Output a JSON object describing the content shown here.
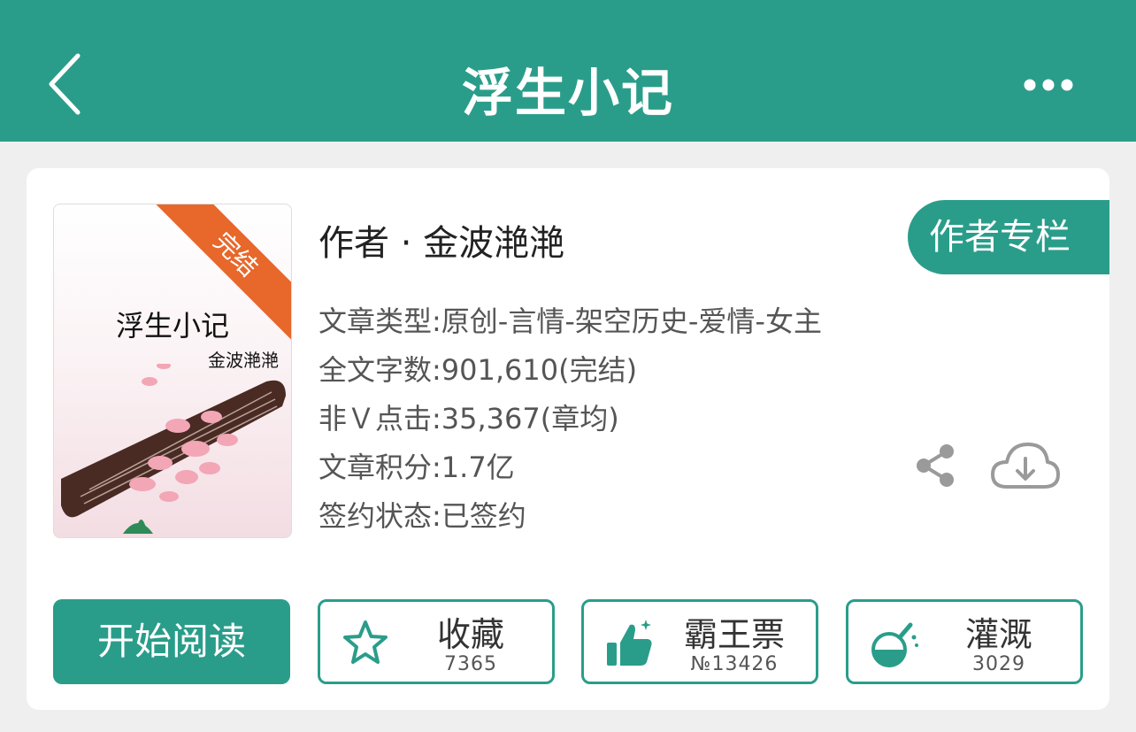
{
  "header": {
    "title": "浮生小记",
    "back_icon": "chevron-left-icon",
    "more_icon": "more-dots-icon",
    "background_color": "#2a9d8a"
  },
  "book": {
    "cover": {
      "badge": "完结",
      "title": "浮生小记",
      "author": "金波滟滟"
    },
    "author_line": "作者 · 金波滟滟",
    "author_column_label": "作者专栏",
    "info": {
      "genre": "文章类型:原创-言情-架空历史-爱情-女主",
      "word_count": "全文字数:901,610(完结)",
      "clicks": "非Ｖ点击:35,367(章均)",
      "score": "文章积分:1.7亿",
      "contract": "签约状态:已签约"
    }
  },
  "actions": {
    "read_label": "开始阅读",
    "favorite": {
      "label": "收藏",
      "count": "7365",
      "icon": "star-icon"
    },
    "ticket": {
      "label": "霸王票",
      "count": "№13426",
      "icon": "thumbs-up-icon"
    },
    "nutrient": {
      "label": "灌溉",
      "count": "3029",
      "icon": "flask-icon"
    },
    "share_icon": "share-icon",
    "download_icon": "cloud-download-icon"
  },
  "colors": {
    "accent": "#2a9d8a",
    "badge": "#e8672a"
  }
}
